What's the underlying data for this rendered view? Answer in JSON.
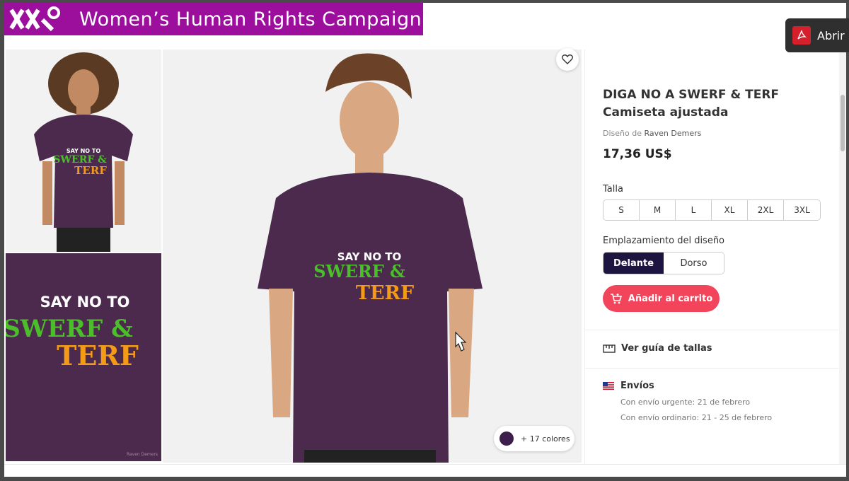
{
  "brand": {
    "title": "Women’s Human Rights Campaign",
    "color": "#9c0f9d"
  },
  "pdf_button": {
    "label": "Abrir"
  },
  "artwork": {
    "line1": "SAY",
    "line1_em": "NO",
    "line1_end": "TO",
    "line2": "SWERF &",
    "line3": "TERF",
    "signature": "Raven Demers"
  },
  "product": {
    "title_line1": "DIGA NO A SWERF & TERF",
    "title_line2": "Camiseta ajustada",
    "designer_prefix": "Diseño de",
    "designer_name": "Raven Demers",
    "price": "17,36 US$"
  },
  "size": {
    "label": "Talla",
    "options": [
      "S",
      "M",
      "L",
      "XL",
      "2XL",
      "3XL"
    ]
  },
  "placement": {
    "label": "Emplazamiento del diseño",
    "options": [
      "Delante",
      "Dorso"
    ],
    "selected": "Delante"
  },
  "cart": {
    "label": "Añadir al carrito",
    "color": "#f2445a"
  },
  "colors": {
    "label": "+ 17 colores",
    "swatch": "#3e1f4c"
  },
  "size_guide": {
    "label": "Ver guía de tallas"
  },
  "shipping": {
    "label": "Envíos",
    "urgent": "Con envío urgente: 21 de febrero",
    "regular": "Con envío ordinario: 21 - 25 de febrero"
  }
}
